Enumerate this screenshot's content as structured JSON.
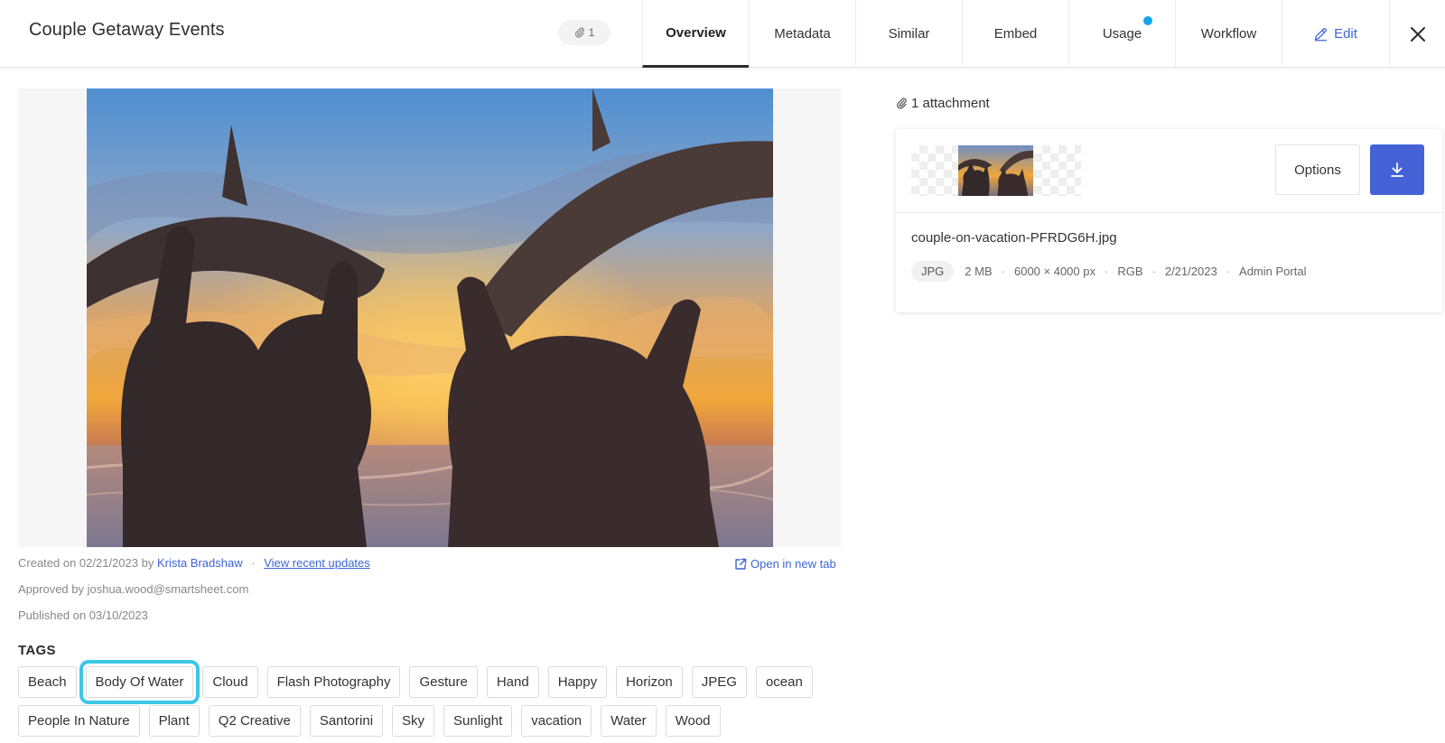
{
  "header": {
    "title": "Couple Getaway Events",
    "attachment_count": "1",
    "tabs": [
      "Overview",
      "Metadata",
      "Similar",
      "Embed",
      "Usage",
      "Workflow"
    ],
    "edit_label": "Edit",
    "active_tab": "Overview",
    "usage_dot_color": "#13a4ea",
    "accent_color": "#3e64d6"
  },
  "asset": {
    "created_prefix": "Created on 02/21/2023 by",
    "created_by": "Krista Bradshaw",
    "view_updates": "View recent updates",
    "approved": "Approved by joshua.wood@smartsheet.com",
    "published": "Published on 03/10/2023",
    "open_new_tab": "Open in new tab"
  },
  "tags": {
    "heading": "TAGS",
    "items": [
      "Beach",
      "Body Of Water",
      "Cloud",
      "Flash Photography",
      "Gesture",
      "Hand",
      "Happy",
      "Horizon",
      "JPEG",
      "ocean",
      "People In Nature",
      "Plant",
      "Q2 Creative",
      "Santorini",
      "Sky",
      "Sunlight",
      "vacation",
      "Water",
      "Wood"
    ],
    "highlighted": "Body Of Water",
    "highlight_color": "#3ec6e8"
  },
  "attachments": {
    "count_label": "1 attachment",
    "options_label": "Options",
    "download_color": "#4462d6",
    "file": {
      "name": "couple-on-vacation-PFRDG6H.jpg",
      "type": "JPG",
      "size": "2 MB",
      "dimensions": "6000 × 4000 px",
      "color_mode": "RGB",
      "date": "2/21/2023",
      "source": "Admin Portal"
    }
  }
}
